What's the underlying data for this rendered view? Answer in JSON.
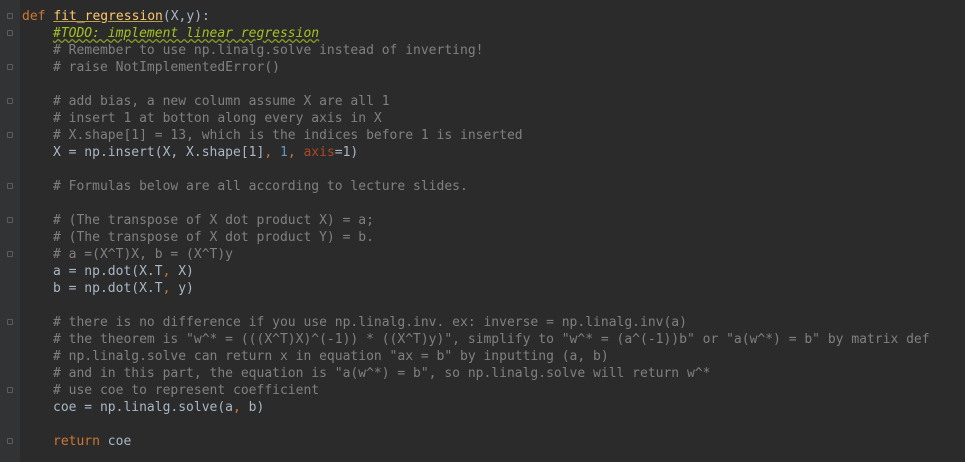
{
  "code": {
    "def_keyword": "def",
    "func_name": "fit_regression",
    "func_params": "(X,y):",
    "lines": {
      "l2": "#TODO: implement linear regression",
      "l3": "# Remember to use np.linalg.solve instead of inverting!",
      "l4": "# raise NotImplementedError()",
      "l6": "# add bias, a new column assume X are all 1",
      "l7": "# insert 1 at botton along every axis in X",
      "l8": "# X.shape[1] = 13, which is the indices before 1 is inserted",
      "l9_a": "X = np.insert(X, X.shape[1]",
      "l9_b": ", ",
      "l9_c": "1",
      "l9_d": ", ",
      "l9_e": "axis",
      "l9_f": "=1)",
      "l11": "# Formulas below are all according to lecture slides.",
      "l13": "# (The transpose of X dot product X) = a;",
      "l14": "# (The transpose of X dot product Y) = b.",
      "l15": "# a =(X^T)X, b = (X^T)y",
      "l16_a": "a = np.dot(X.T",
      "l16_b": ",",
      "l16_c": " X)",
      "l17_a": "b = np.dot(X.T",
      "l17_b": ",",
      "l17_c": " y)",
      "l19": "# there is no difference if you use np.linalg.inv. ex: inverse = np.linalg.inv(a)",
      "l20": "# the theorem is \"w^* = (((X^T)X)^(-1)) * ((X^T)y)\", simplify to \"w^* = (a^(-1))b\" or \"a(w^*) = b\" by matrix def",
      "l21": "# np.linalg.solve can return x in equation \"ax = b\" by inputting (a, b)",
      "l22": "# and in this part, the equation is \"a(w^*) = b\", so np.linalg.solve will return w^*",
      "l23": "# use coe to represent coefficient",
      "l24_a": "coe = np.linalg.solve(a",
      "l24_b": ",",
      "l24_c": " b)",
      "l26_kw": "return",
      "l26_val": " coe"
    }
  },
  "colors": {
    "background": "#2b2b2b",
    "gutter": "#313335",
    "keyword": "#cc7832",
    "function": "#ffc66d",
    "comment": "#808080",
    "todo": "#a8c023",
    "number": "#6897bb",
    "kwarg": "#aa4926",
    "text": "#a9b7c6"
  }
}
